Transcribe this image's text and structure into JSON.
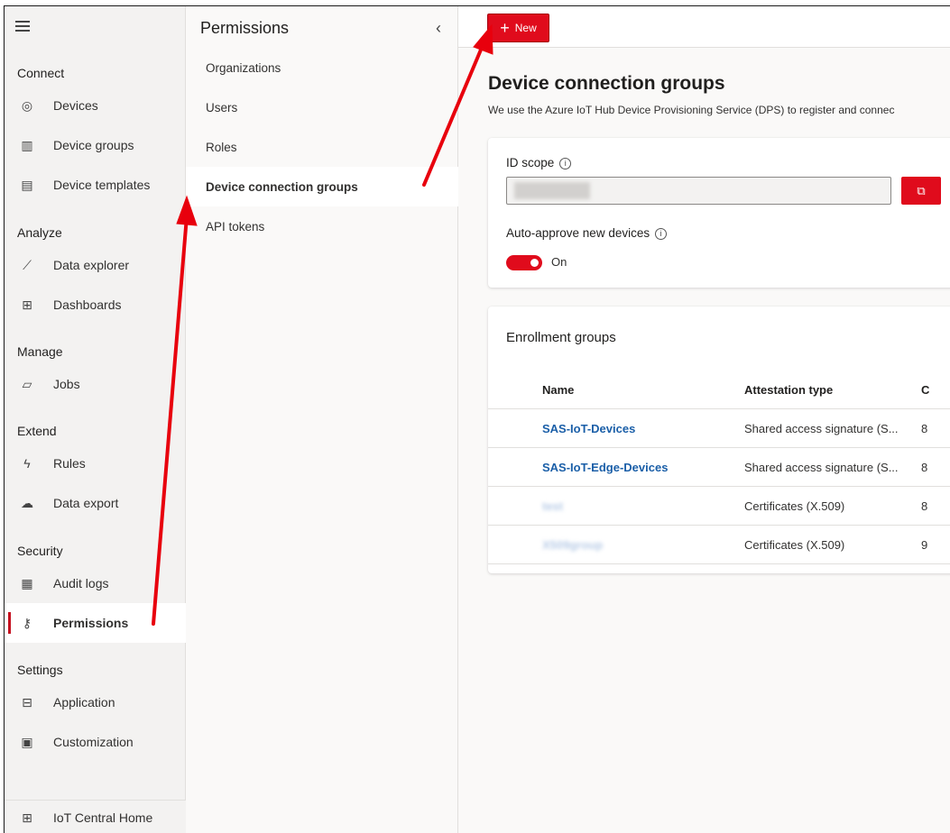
{
  "nav": {
    "sections": [
      {
        "label": "Connect",
        "items": [
          {
            "icon": "devices-icon",
            "glyph": "◎",
            "label": "Devices"
          },
          {
            "icon": "device-groups-icon",
            "glyph": "▥",
            "label": "Device groups"
          },
          {
            "icon": "device-templates-icon",
            "glyph": "▤",
            "label": "Device templates"
          }
        ]
      },
      {
        "label": "Analyze",
        "items": [
          {
            "icon": "data-explorer-icon",
            "glyph": "⟋",
            "label": "Data explorer"
          },
          {
            "icon": "dashboards-icon",
            "glyph": "⊞",
            "label": "Dashboards"
          }
        ]
      },
      {
        "label": "Manage",
        "items": [
          {
            "icon": "jobs-icon",
            "glyph": "▱",
            "label": "Jobs"
          }
        ]
      },
      {
        "label": "Extend",
        "items": [
          {
            "icon": "rules-icon",
            "glyph": "ϟ",
            "label": "Rules"
          },
          {
            "icon": "data-export-icon",
            "glyph": "☁",
            "label": "Data export"
          }
        ]
      },
      {
        "label": "Security",
        "items": [
          {
            "icon": "audit-logs-icon",
            "glyph": "▦",
            "label": "Audit logs"
          },
          {
            "icon": "permissions-icon",
            "glyph": "⚷",
            "label": "Permissions",
            "active": true
          }
        ]
      },
      {
        "label": "Settings",
        "items": [
          {
            "icon": "application-icon",
            "glyph": "⊟",
            "label": "Application"
          },
          {
            "icon": "customization-icon",
            "glyph": "▣",
            "label": "Customization"
          }
        ]
      }
    ],
    "home": {
      "icon": "home-icon",
      "glyph": "⊞",
      "label": "IoT Central Home"
    }
  },
  "subnav": {
    "title": "Permissions",
    "items": [
      "Organizations",
      "Users",
      "Roles",
      "Device connection groups",
      "API tokens"
    ],
    "active_index": 3
  },
  "toolbar": {
    "new_label": "New"
  },
  "page": {
    "title": "Device connection groups",
    "description": "We use the Azure IoT Hub Device Provisioning Service (DPS) to register and connec"
  },
  "dps_card": {
    "id_scope_label": "ID scope",
    "auto_approve_label": "Auto-approve new devices",
    "toggle_state": "On"
  },
  "enrollment": {
    "title": "Enrollment groups",
    "columns": [
      "Name",
      "Attestation type",
      "C"
    ],
    "rows": [
      {
        "name": "SAS-IoT-Devices",
        "attestation": "Shared access signature (S...",
        "extra": "8",
        "blurred": false
      },
      {
        "name": "SAS-IoT-Edge-Devices",
        "attestation": "Shared access signature (S...",
        "extra": "8",
        "blurred": false
      },
      {
        "name": "test",
        "attestation": "Certificates (X.509)",
        "extra": "8",
        "blurred": true
      },
      {
        "name": "X509group",
        "attestation": "Certificates (X.509)",
        "extra": "9",
        "blurred": true
      }
    ]
  },
  "colors": {
    "accent": "#e00b1c",
    "link": "#1b5fa8",
    "annotation_arrow": "#e8000d"
  }
}
